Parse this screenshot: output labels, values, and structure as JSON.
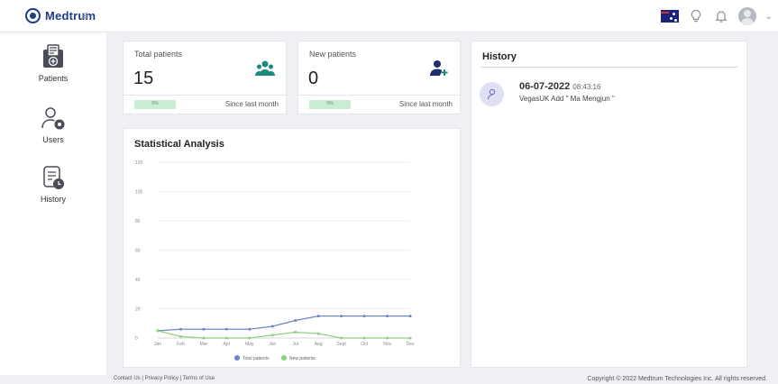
{
  "app": {
    "brand": "Medtrum"
  },
  "header": {
    "language": "English (Australia)"
  },
  "sidebar": {
    "items": [
      {
        "label": "Patients"
      },
      {
        "label": "Users"
      },
      {
        "label": "History"
      }
    ]
  },
  "stats": {
    "total": {
      "title": "Total patients",
      "value": "15",
      "pct": "0%",
      "pct_value": 0,
      "since": "Since last month"
    },
    "new": {
      "title": "New patients",
      "value": "0",
      "pct": "0%",
      "pct_value": 0,
      "since": "Since last month"
    }
  },
  "analysis": {
    "title": "Statistical Analysis"
  },
  "chart_data": {
    "type": "line",
    "categories": [
      "Jan",
      "Feb",
      "Mar",
      "Apr",
      "May",
      "Jun",
      "Jul",
      "Aug",
      "Sept",
      "Oct",
      "Nov",
      "Dev"
    ],
    "ylim": [
      0,
      120
    ],
    "yticks": [
      0,
      20,
      40,
      60,
      80,
      100,
      120
    ],
    "grid": true,
    "legend_position": "bottom",
    "series": [
      {
        "name": "Total patients",
        "color": "#6e85c8",
        "values": [
          5,
          6,
          6,
          6,
          6,
          8,
          12,
          15,
          15,
          15,
          15,
          15
        ]
      },
      {
        "name": "New patients",
        "color": "#8fd07d",
        "values": [
          5,
          1,
          0,
          0,
          0,
          2,
          4,
          3,
          0,
          0,
          0,
          0
        ]
      }
    ]
  },
  "history": {
    "title": "History",
    "entries": [
      {
        "date": "06-07-2022",
        "time": "08:43:16",
        "text": "VegasUK Add \" Ma Mengjun \""
      }
    ]
  },
  "footer": {
    "contact": "Contact Us",
    "privacy": "Privacy Policy",
    "terms": "Terms of Use",
    "sep": "|",
    "copyright": "Copyright © 2022 Medtrum Technologies Inc. All rights reserved."
  }
}
